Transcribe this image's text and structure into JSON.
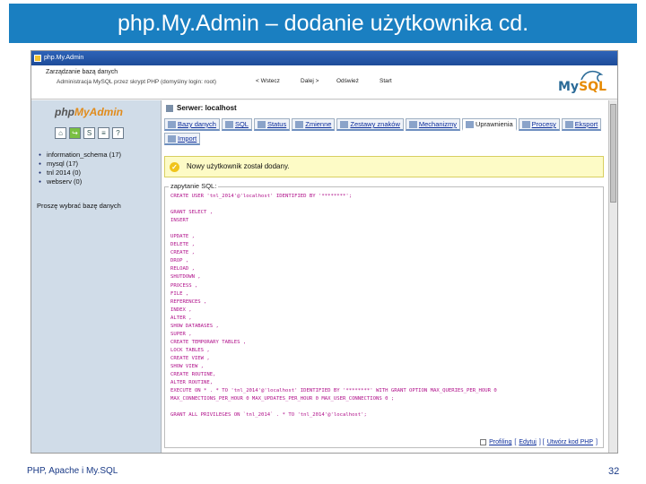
{
  "slide": {
    "title": "php.My.Admin – dodanie użytkownika cd.",
    "footer_left": "PHP, Apache i My.SQL",
    "page_number": "32"
  },
  "window": {
    "title": "php.My.Admin"
  },
  "header": {
    "line1": "Zarządzanie bazą danych",
    "line2": "Administracja MySQL przez skrypt PHP (domyślny login: root)",
    "nav": [
      "< Wstecz",
      "Dalej >",
      "Odśwież",
      "Start"
    ],
    "logo": {
      "my": "My",
      "sql": "SQL"
    }
  },
  "sidebar": {
    "logo": {
      "php": "php",
      "my_admin": "MyAdmin"
    },
    "icons": [
      "home-icon",
      "exit-icon",
      "sql-query-icon",
      "docs-icon",
      "help-icon"
    ],
    "databases": [
      "information_schema (17)",
      "mysql (17)",
      "tnl 2014 (0)",
      "webserv (0)"
    ],
    "choose_db": "Proszę wybrać bazę danych"
  },
  "main": {
    "server_label": "Serwer: localhost",
    "tabs": [
      "Bazy danych",
      "SQL",
      "Status",
      "Zmienne",
      "Zestawy znaków",
      "Mechanizmy",
      "Uprawnienia",
      "Procesy",
      "Eksport",
      "Import"
    ],
    "active_tab": "Uprawnienia",
    "notice": "Nowy użytkownik został dodany.",
    "sql_legend": "zapytanie SQL:",
    "sql_lines": [
      "CREATE USER 'tnl_2014'@'localhost' IDENTIFIED BY '********';",
      "",
      "GRANT SELECT ,",
      "INSERT",
      "",
      "UPDATE ,",
      "DELETE ,",
      "CREATE ,",
      "DROP ,",
      "RELOAD ,",
      "SHUTDOWN ,",
      "PROCESS ,",
      "FILE ,",
      "REFERENCES ,",
      "INDEX ,",
      "ALTER ,",
      "SHOW DATABASES ,",
      "SUPER ,",
      "CREATE TEMPORARY TABLES ,",
      "LOCK TABLES ,",
      "CREATE VIEW ,",
      "SHOW VIEW ,",
      "CREATE ROUTINE,",
      "ALTER ROUTINE,",
      "EXECUTE ON * . * TO 'tnl_2014'@'localhost' IDENTIFIED BY '********' WITH GRANT OPTION MAX_QUERIES_PER_HOUR 0",
      "MAX_CONNECTIONS_PER_HOUR 0 MAX_UPDATES_PER_HOUR 0 MAX_USER_CONNECTIONS 0 ;",
      "",
      "GRANT ALL PRIVILEGES ON `tnl_2014` . * TO 'tnl_2014'@'localhost';"
    ],
    "bottom_links": [
      "Profiling",
      "Edytuj",
      "Utwórz kod PHP"
    ]
  }
}
